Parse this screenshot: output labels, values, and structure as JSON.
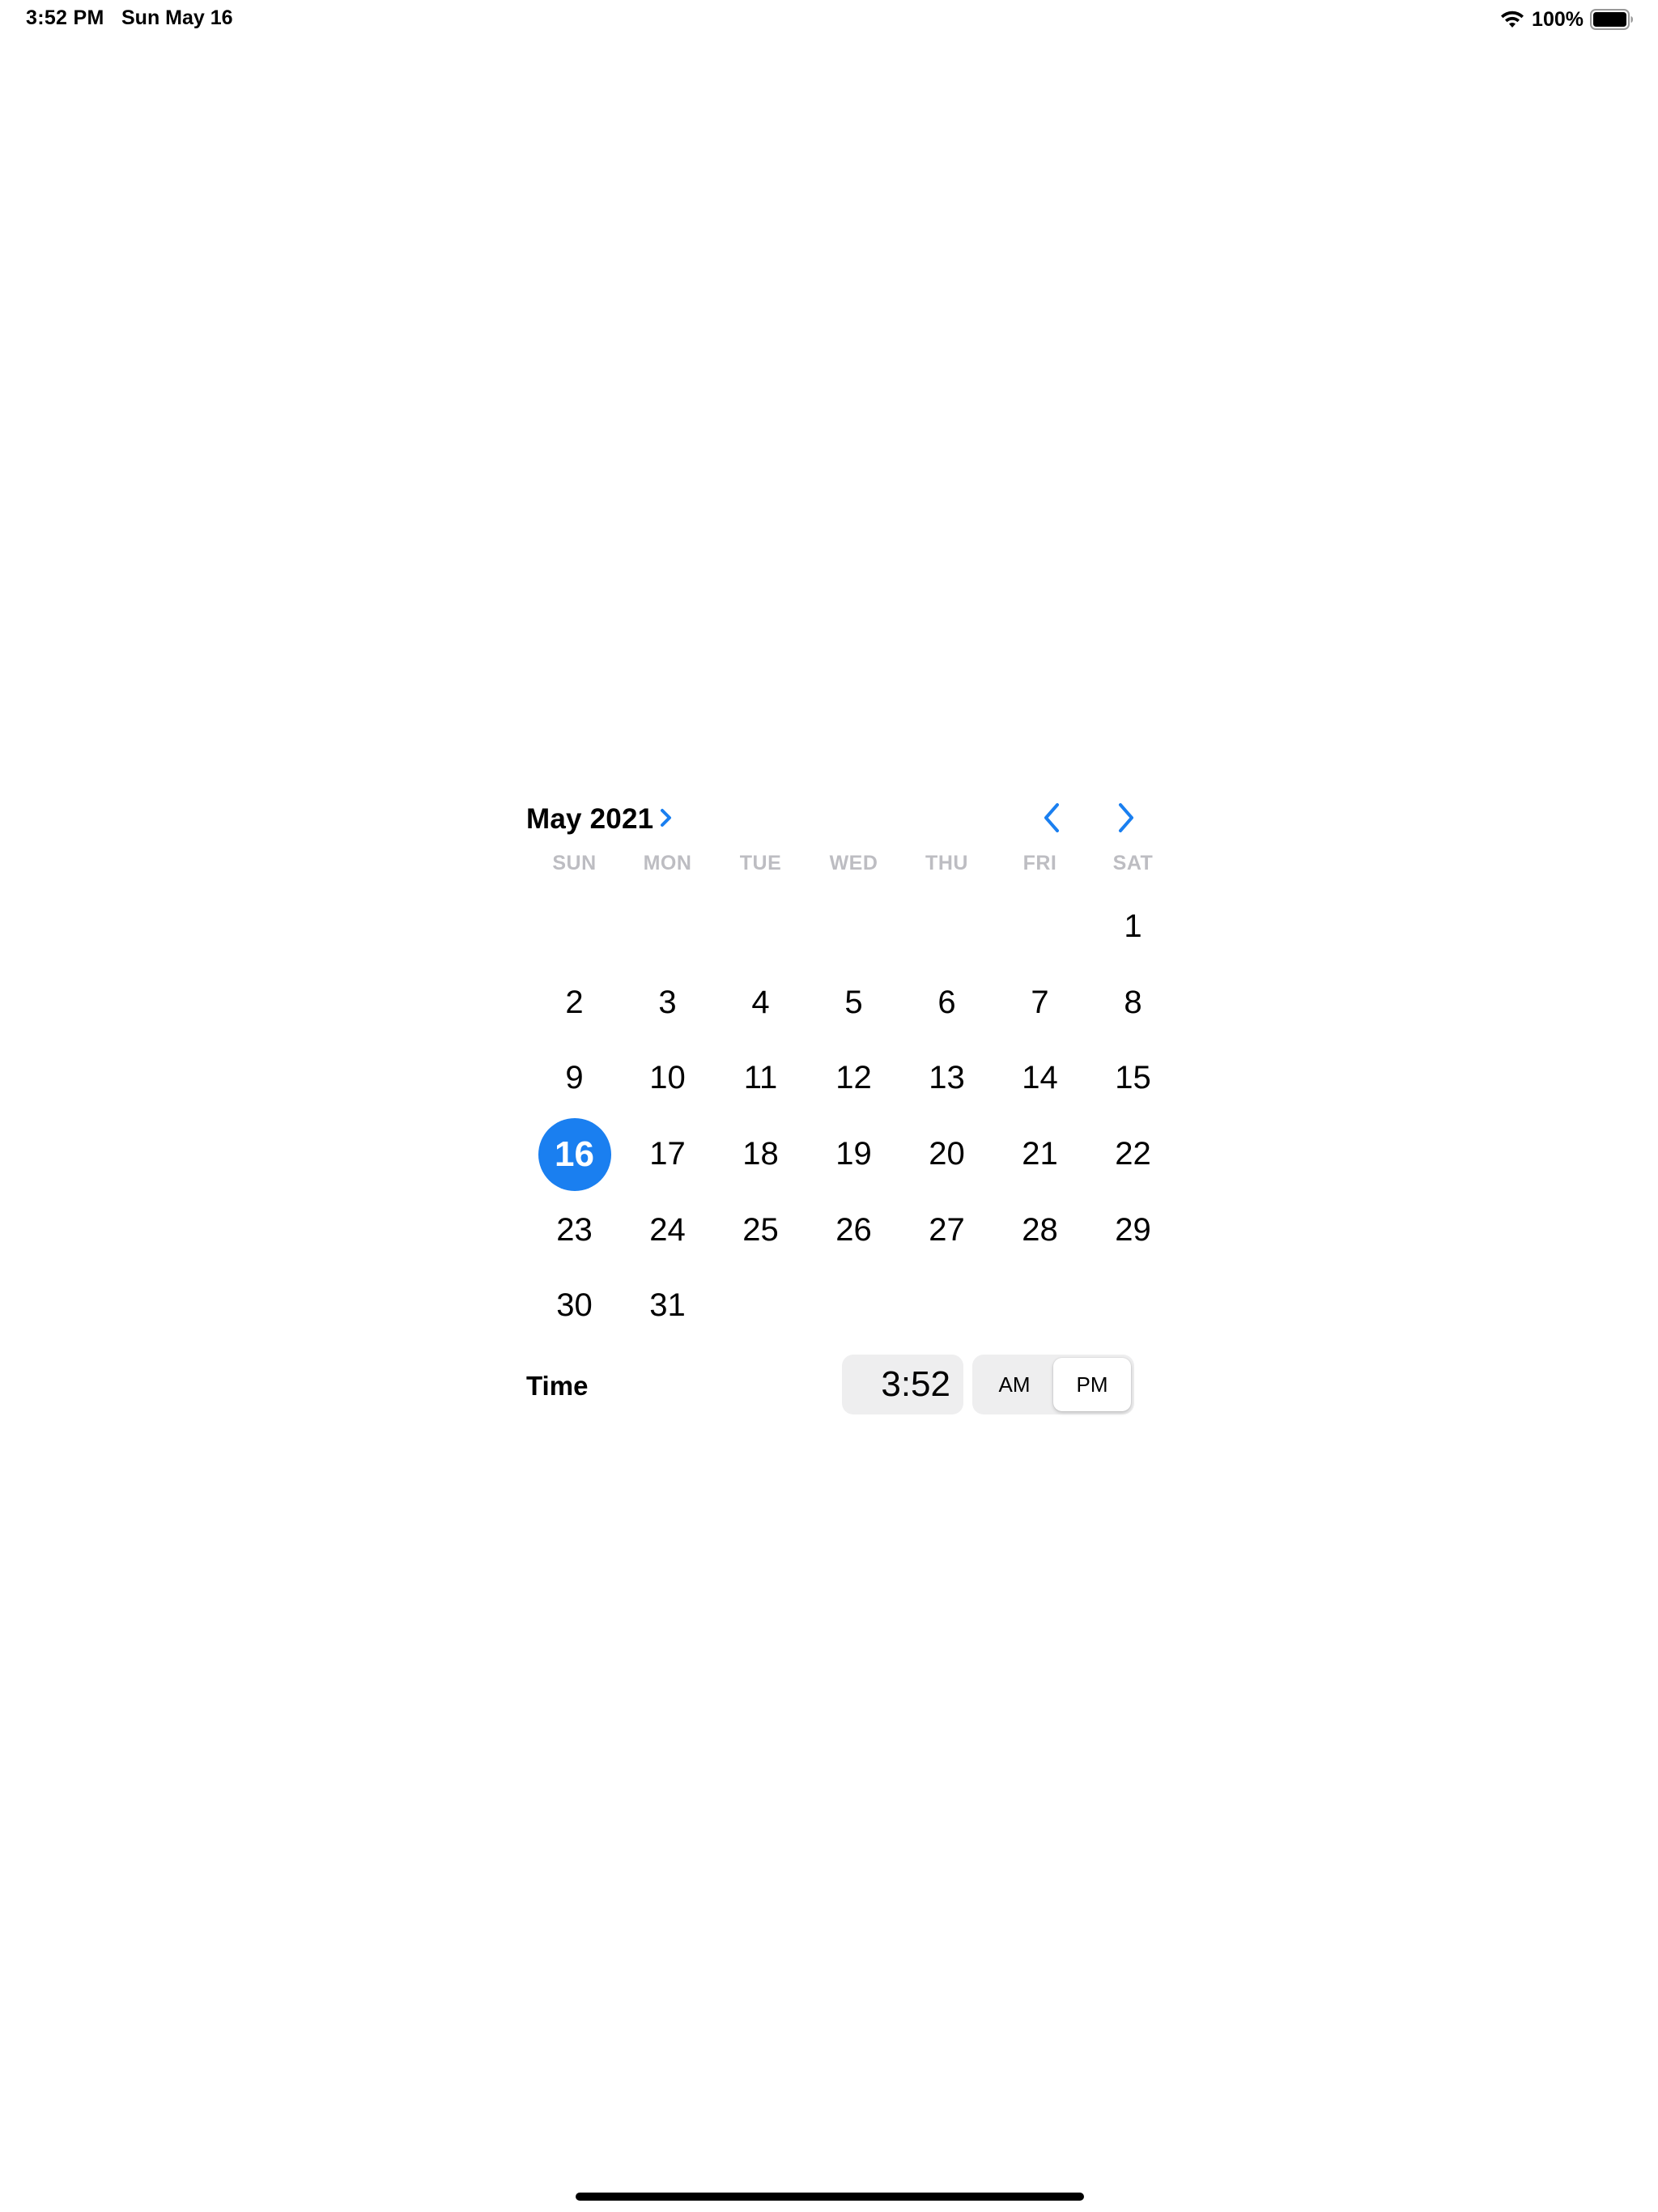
{
  "status_bar": {
    "time": "3:52 PM",
    "date": "Sun May 16",
    "battery_percent": "100%",
    "icons": [
      "wifi-icon",
      "battery-icon"
    ]
  },
  "calendar": {
    "month_label": "May 2021",
    "accent_color": "#1a7ff0",
    "nav": {
      "prev_icon": "chevron-left-icon",
      "next_icon": "chevron-right-icon"
    },
    "weekdays": [
      "SUN",
      "MON",
      "TUE",
      "WED",
      "THU",
      "FRI",
      "SAT"
    ],
    "leading_empty_days": 6,
    "days": [
      "1",
      "2",
      "3",
      "4",
      "5",
      "6",
      "7",
      "8",
      "9",
      "10",
      "11",
      "12",
      "13",
      "14",
      "15",
      "16",
      "17",
      "18",
      "19",
      "20",
      "21",
      "22",
      "23",
      "24",
      "25",
      "26",
      "27",
      "28",
      "29",
      "30",
      "31"
    ],
    "selected_day": "16"
  },
  "time_picker": {
    "label": "Time",
    "value": "3:52",
    "am_label": "AM",
    "pm_label": "PM",
    "selected_period": "PM"
  }
}
